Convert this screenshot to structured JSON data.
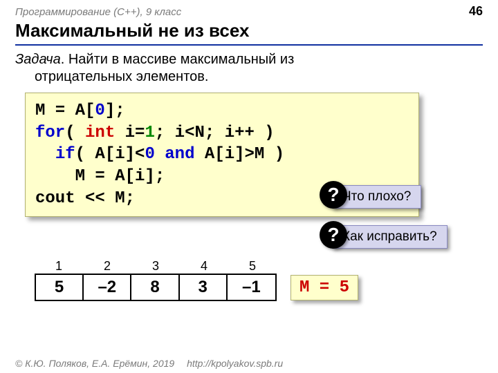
{
  "header": {
    "course": "Программирование (C++), 9 класс",
    "page_number": "46"
  },
  "title": "Максимальный не из всех",
  "task": {
    "label": "Задача",
    "line1_rest": ". Найти в массиве максимальный из",
    "line2": "отрицательных элементов."
  },
  "code": {
    "l1_a": "M = A[",
    "l1_b": "0",
    "l1_c": "];",
    "l2_a": "for",
    "l2_b": "( ",
    "l2_c": "int",
    "l2_d": " i=",
    "l2_e": "1",
    "l2_f": "; i<N; i++ )",
    "l3_a": "  ",
    "l3_b": "if",
    "l3_c": "( A[i]<",
    "l3_d": "0",
    "l3_e": " ",
    "l3_f": "and",
    "l3_g": " A[i]>M )",
    "l4": "    M = A[i];",
    "l5": "cout << M;"
  },
  "callouts": {
    "q_mark": "?",
    "c1": "Что плохо?",
    "c2": "Как исправить?"
  },
  "array": {
    "indices": [
      "1",
      "2",
      "3",
      "4",
      "5"
    ],
    "values": [
      "5",
      "–2",
      "8",
      "3",
      "–1"
    ]
  },
  "result": "M = 5",
  "footer": {
    "copyright": "© К.Ю. Поляков, Е.А. Ерёмин, 2019",
    "url": "http://kpolyakov.spb.ru"
  }
}
